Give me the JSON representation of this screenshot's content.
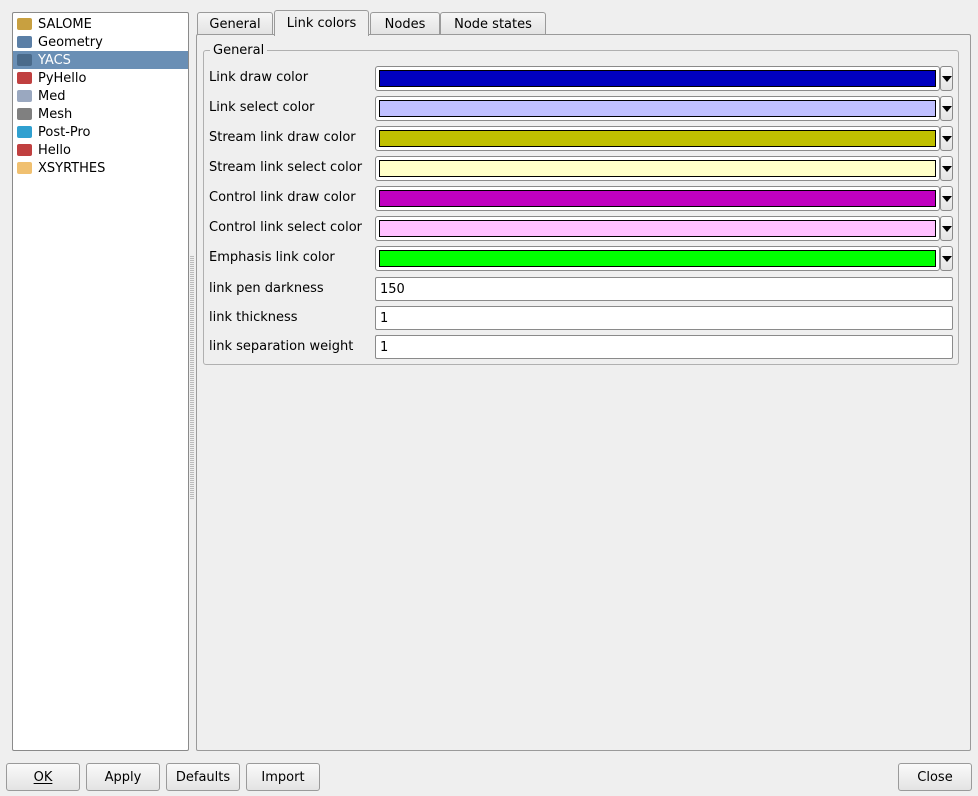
{
  "modules": [
    {
      "label": "SALOME",
      "icon": "salome-icon",
      "color": "#c8a040"
    },
    {
      "label": "Geometry",
      "icon": "geometry-icon",
      "color": "#5b7fa6"
    },
    {
      "label": "YACS",
      "icon": "yacs-icon",
      "color": "#4a6a8a",
      "selected": true
    },
    {
      "label": "PyHello",
      "icon": "pyhello-icon",
      "color": "#c04040"
    },
    {
      "label": "Med",
      "icon": "med-icon",
      "color": "#9aa8c0"
    },
    {
      "label": "Mesh",
      "icon": "mesh-icon",
      "color": "#808080"
    },
    {
      "label": "Post-Pro",
      "icon": "postpro-icon",
      "color": "#30a0d0"
    },
    {
      "label": "Hello",
      "icon": "hello-icon",
      "color": "#c04040"
    },
    {
      "label": "XSYRTHES",
      "icon": "xsyrthes-icon",
      "color": "#f0c070"
    }
  ],
  "tabs": [
    "General",
    "Link colors",
    "Nodes",
    "Node states"
  ],
  "active_tab": "Link colors",
  "group_title": "General",
  "color_rows": [
    {
      "label": "Link draw color",
      "color": "#0000c0"
    },
    {
      "label": "Link select color",
      "color": "#c0c0ff"
    },
    {
      "label": "Stream link draw color",
      "color": "#c0c000"
    },
    {
      "label": "Stream link select color",
      "color": "#ffffc8"
    },
    {
      "label": "Control link draw color",
      "color": "#c000c0"
    },
    {
      "label": "Control link select color",
      "color": "#ffc0ff"
    },
    {
      "label": "Emphasis link color",
      "color": "#00ff00"
    }
  ],
  "value_rows": [
    {
      "label": "link pen darkness",
      "value": "150"
    },
    {
      "label": "link thickness",
      "value": "1"
    },
    {
      "label": "link separation weight",
      "value": "1"
    }
  ],
  "buttons": {
    "ok": "OK",
    "apply": "Apply",
    "defaults": "Defaults",
    "import": "Import",
    "close": "Close"
  }
}
